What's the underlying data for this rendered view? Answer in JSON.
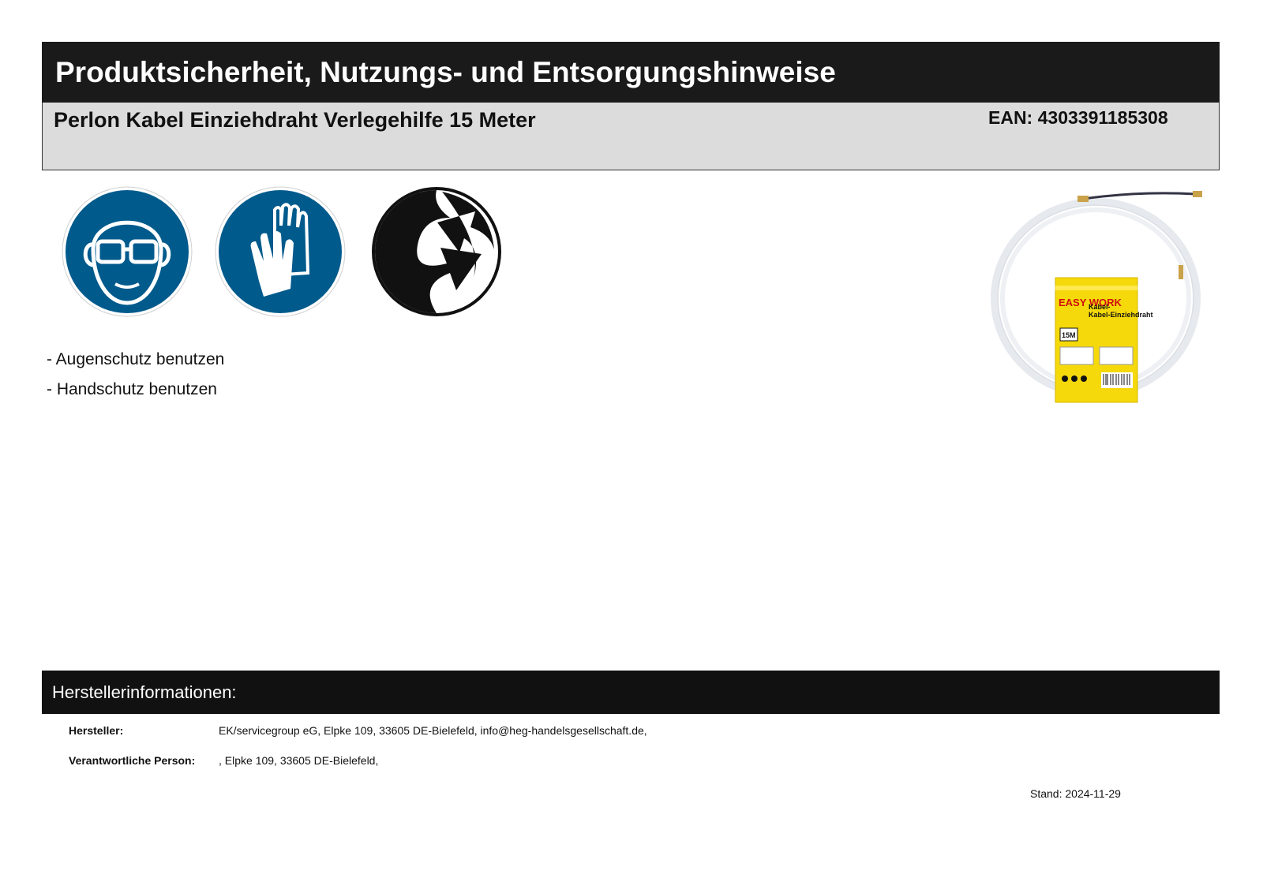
{
  "header": {
    "title": "Produktsicherheit, Nutzungs- und Entsorgungshinweise",
    "product_name": "Perlon Kabel Einziehdraht Verlegehilfe 15 Meter",
    "ean": "EAN: 4303391185308"
  },
  "symbols": [
    {
      "icon": "eye-protection-icon",
      "color": "#005a8c"
    },
    {
      "icon": "hand-protection-icon",
      "color": "#005a8c"
    },
    {
      "icon": "green-dot-recycling-icon",
      "color": "#111111"
    }
  ],
  "notes": [
    "- Augenschutz benutzen",
    "- Handschutz benutzen"
  ],
  "product_image": {
    "package_brand": "EASY WORK",
    "package_title": "Kabel-Einziehdraht",
    "package_length": "15M",
    "package_color": "#f5d90a"
  },
  "manufacturer": {
    "heading": "Herstellerinformationen:",
    "rows": [
      {
        "label": "Hersteller:",
        "value": "EK/servicegroup eG, Elpke 109, 33605 DE-Bielefeld, info@heg-handelsgesellschaft.de,"
      },
      {
        "label": "Verantwortliche Person:",
        "value": ", Elpke 109, 33605 DE-Bielefeld,"
      }
    ]
  },
  "stand": "Stand: 2024-11-29"
}
